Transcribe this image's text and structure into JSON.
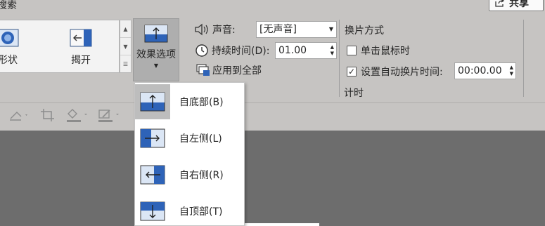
{
  "ribbon": {
    "search_tab_label": "搜索",
    "share_label": "共享",
    "gallery": {
      "items": [
        {
          "label": "形状",
          "icon": "shape-circle-icon"
        },
        {
          "label": "揭开",
          "icon": "reveal-arrow-icon"
        }
      ]
    },
    "effect_options_label": "效果选项",
    "sound_label": "声音:",
    "sound_value": "[无声音]",
    "duration_label": "持续时间(D):",
    "duration_value": "01.00",
    "apply_all_label": "应用到全部",
    "advance_group_title": "换片方式",
    "on_click_label": "单击鼠标时",
    "on_click_checked": false,
    "auto_after_label": "设置自动换片时间:",
    "auto_after_checked": true,
    "auto_after_value": "00:00.00",
    "timing_group_label": "计时"
  },
  "effect_menu": {
    "items": [
      {
        "label": "自底部(B)",
        "icon": "from-bottom-icon",
        "selected": true
      },
      {
        "label": "自左侧(L)",
        "icon": "from-left-icon",
        "selected": false
      },
      {
        "label": "自右侧(R)",
        "icon": "from-right-icon",
        "selected": false
      },
      {
        "label": "自顶部(T)",
        "icon": "from-top-icon",
        "selected": false
      }
    ]
  },
  "colors": {
    "ribbon_bg": "#c6c4c2",
    "canvas_bg": "#6d6d6d",
    "icon_blue": "#2e63b8",
    "selected_bg": "#bdbdbd"
  }
}
